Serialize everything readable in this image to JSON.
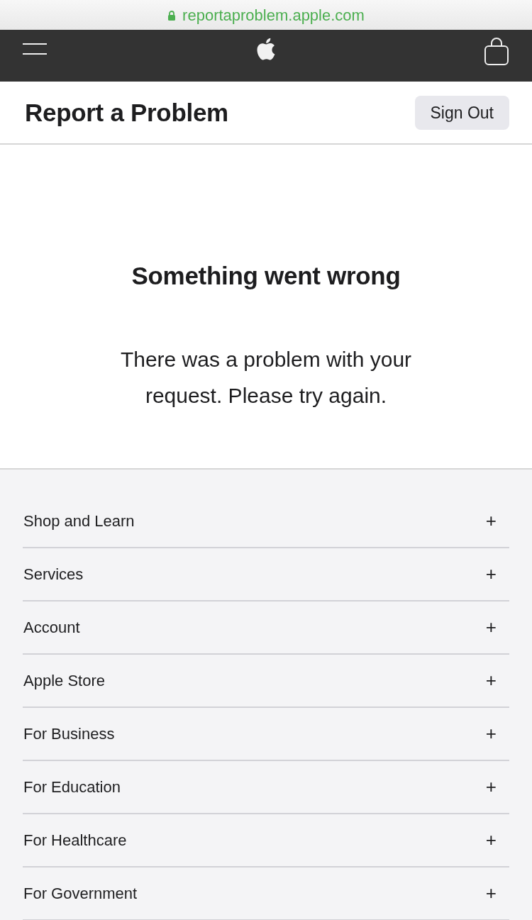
{
  "browser": {
    "url": "reportaproblem.apple.com",
    "secure": true
  },
  "header": {
    "title": "Report a Problem",
    "sign_out": "Sign Out"
  },
  "message": {
    "title": "Something went wrong",
    "body": "There was a problem with your request. Please try again."
  },
  "footer": {
    "sections": [
      {
        "label": "Shop and Learn",
        "toggle": "+"
      },
      {
        "label": "Services",
        "toggle": "+"
      },
      {
        "label": "Account",
        "toggle": "+"
      },
      {
        "label": "Apple Store",
        "toggle": "+"
      },
      {
        "label": "For Business",
        "toggle": "+"
      },
      {
        "label": "For Education",
        "toggle": "+"
      },
      {
        "label": "For Healthcare",
        "toggle": "+"
      },
      {
        "label": "For Government",
        "toggle": "+"
      }
    ]
  }
}
